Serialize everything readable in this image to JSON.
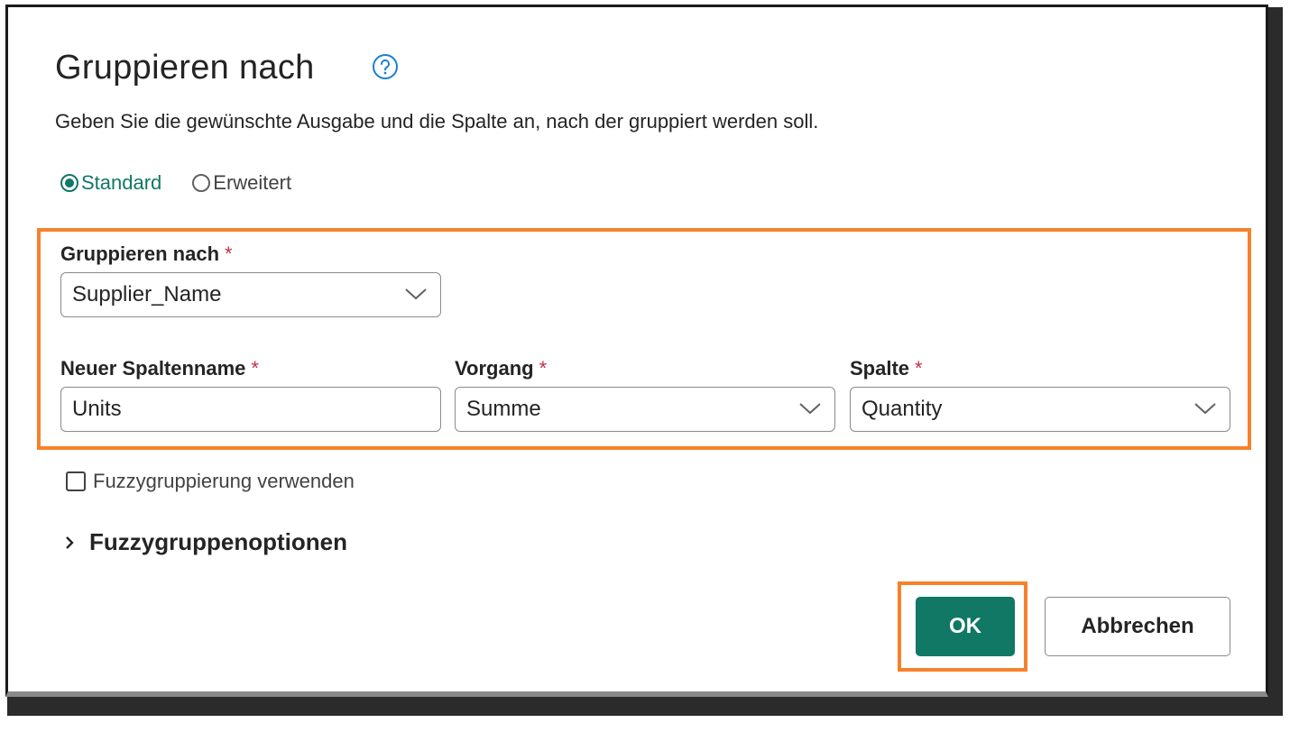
{
  "dialog": {
    "title": "Gruppieren nach",
    "help_icon": "question-circle-icon",
    "subtitle": "Geben Sie die gewünschte Ausgabe und die Spalte an, nach der gruppiert werden soll.",
    "accent_color": "#117865",
    "highlight_color": "#f7812b"
  },
  "mode": {
    "options": [
      {
        "label": "Standard",
        "checked": true
      },
      {
        "label": "Erweitert",
        "checked": false
      }
    ]
  },
  "group_by": {
    "label": "Gruppieren nach",
    "required_mark": "*",
    "value": "Supplier_Name"
  },
  "new_column": {
    "label": "Neuer Spaltenname",
    "required_mark": "*",
    "value": "Units"
  },
  "operation": {
    "label": "Vorgang",
    "required_mark": "*",
    "value": "Summe"
  },
  "column": {
    "label": "Spalte",
    "required_mark": "*",
    "value": "Quantity"
  },
  "fuzzy": {
    "checkbox_label": "Fuzzygruppierung verwenden",
    "checked": false,
    "options_label": "Fuzzygruppenoptionen"
  },
  "buttons": {
    "ok": "OK",
    "cancel": "Abbrechen"
  }
}
